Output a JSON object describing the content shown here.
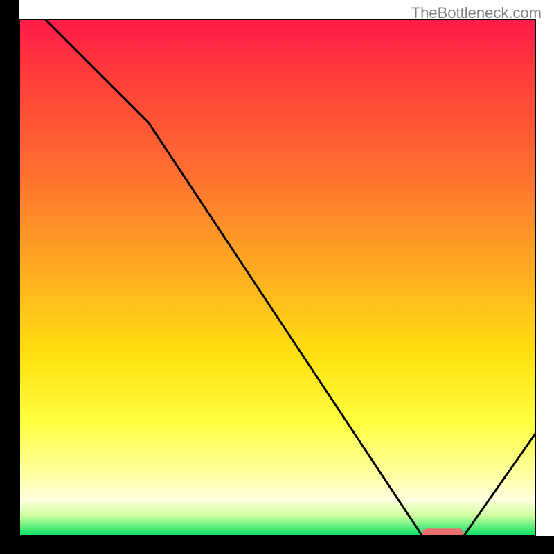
{
  "watermark": "TheBottleneck.com",
  "chart_data": {
    "type": "line",
    "title": "",
    "xlabel": "",
    "ylabel": "",
    "xlim": [
      0,
      100
    ],
    "ylim": [
      0,
      100
    ],
    "x": [
      0,
      5,
      25,
      78,
      86,
      100
    ],
    "values": [
      107,
      100,
      80,
      0,
      0,
      20
    ],
    "gradient_stops": [
      {
        "offset": 0.0,
        "color": "#ff1a4a"
      },
      {
        "offset": 0.1,
        "color": "#ff3a3a"
      },
      {
        "offset": 0.3,
        "color": "#ff7030"
      },
      {
        "offset": 0.5,
        "color": "#ffb020"
      },
      {
        "offset": 0.65,
        "color": "#ffe010"
      },
      {
        "offset": 0.78,
        "color": "#ffff40"
      },
      {
        "offset": 0.88,
        "color": "#ffffa0"
      },
      {
        "offset": 0.93,
        "color": "#ffffe0"
      },
      {
        "offset": 0.96,
        "color": "#d0ffa0"
      },
      {
        "offset": 1.0,
        "color": "#00e060"
      }
    ],
    "marker": {
      "x_start": 78,
      "x_end": 86,
      "y": 0.5,
      "color": "#e97070"
    }
  }
}
